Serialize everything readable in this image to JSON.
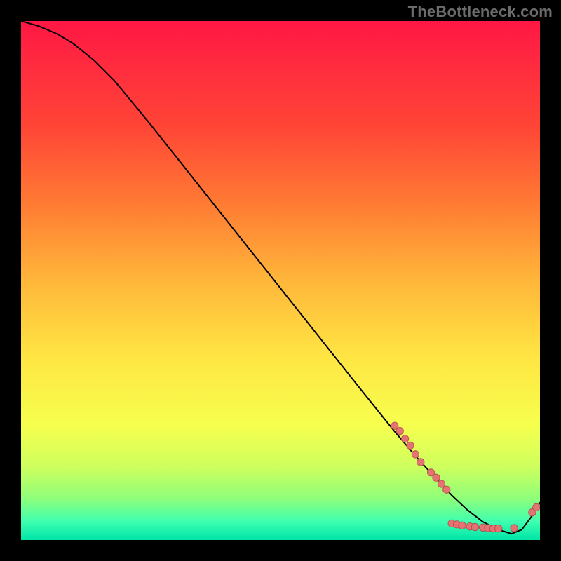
{
  "watermark": "TheBottleneck.com",
  "chart_data": {
    "type": "line",
    "title": "",
    "xlabel": "",
    "ylabel": "",
    "xlim": [
      0,
      100
    ],
    "ylim": [
      0,
      100
    ],
    "grid": false,
    "gradient_stops": [
      {
        "offset": 0.0,
        "color": "#ff1744"
      },
      {
        "offset": 0.08,
        "color": "#ff2a3f"
      },
      {
        "offset": 0.2,
        "color": "#ff4436"
      },
      {
        "offset": 0.35,
        "color": "#ff7a33"
      },
      {
        "offset": 0.5,
        "color": "#ffb63a"
      },
      {
        "offset": 0.65,
        "color": "#ffe643"
      },
      {
        "offset": 0.78,
        "color": "#f6ff4e"
      },
      {
        "offset": 0.86,
        "color": "#cdff5e"
      },
      {
        "offset": 0.92,
        "color": "#8fff7a"
      },
      {
        "offset": 0.965,
        "color": "#3dffb0"
      },
      {
        "offset": 1.0,
        "color": "#00e5a8"
      }
    ],
    "curve": {
      "x": [
        0.0,
        3.5,
        7.0,
        10.0,
        14.0,
        18.0,
        25.0,
        35.0,
        45.0,
        55.0,
        65.0,
        72.0,
        76.0,
        80.0,
        83.0,
        86.0,
        89.0,
        92.0,
        94.5,
        96.5,
        98.5,
        100.0
      ],
      "y": [
        100.0,
        99.0,
        97.5,
        95.7,
        92.5,
        88.5,
        80.0,
        67.4,
        54.8,
        42.2,
        29.6,
        20.9,
        16.2,
        11.8,
        8.6,
        5.8,
        3.5,
        2.0,
        1.2,
        2.0,
        4.7,
        7.2
      ]
    },
    "points": [
      {
        "x": 72.0,
        "y": 22.0
      },
      {
        "x": 73.0,
        "y": 21.0
      },
      {
        "x": 74.0,
        "y": 19.5
      },
      {
        "x": 75.0,
        "y": 18.2
      },
      {
        "x": 76.0,
        "y": 16.5
      },
      {
        "x": 77.0,
        "y": 15.0
      },
      {
        "x": 79.0,
        "y": 13.0
      },
      {
        "x": 80.0,
        "y": 12.0
      },
      {
        "x": 81.0,
        "y": 10.8
      },
      {
        "x": 82.0,
        "y": 9.7
      },
      {
        "x": 83.0,
        "y": 3.2
      },
      {
        "x": 84.0,
        "y": 3.0
      },
      {
        "x": 85.0,
        "y": 2.8
      },
      {
        "x": 86.5,
        "y": 2.6
      },
      {
        "x": 87.5,
        "y": 2.5
      },
      {
        "x": 89.0,
        "y": 2.4
      },
      {
        "x": 90.0,
        "y": 2.3
      },
      {
        "x": 91.0,
        "y": 2.2
      },
      {
        "x": 92.0,
        "y": 2.2
      },
      {
        "x": 95.0,
        "y": 2.3
      },
      {
        "x": 98.5,
        "y": 5.3
      },
      {
        "x": 99.3,
        "y": 6.3
      }
    ],
    "colors": {
      "line": "#000000",
      "point_fill": "#e57373",
      "point_stroke": "#b24a4a"
    },
    "line_width": 2,
    "point_radius": 5.2
  }
}
